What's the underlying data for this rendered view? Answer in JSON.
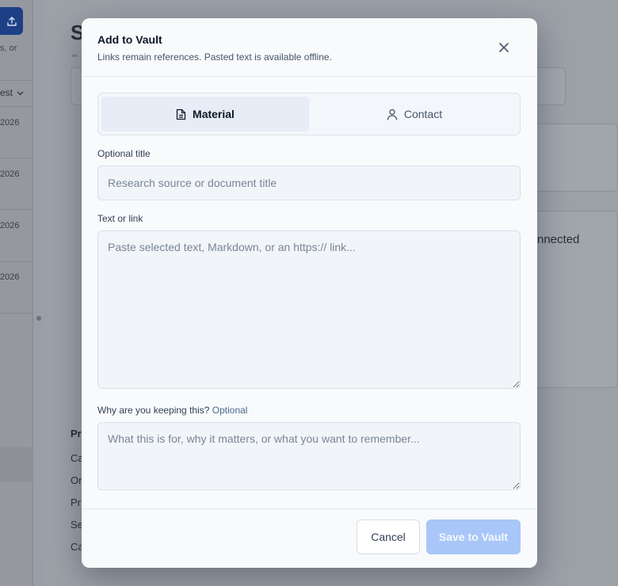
{
  "background": {
    "hint_text": "s, or",
    "sort_label": "est",
    "dates": [
      "2026",
      "2026",
      "2026",
      "2026"
    ],
    "page_title": "S",
    "connected_text": "nnected",
    "section_title": "Pr",
    "section_items": [
      "Ca",
      "Or",
      "Pr",
      "Se",
      "Ca"
    ]
  },
  "modal": {
    "title": "Add to Vault",
    "subtitle": "Links remain references. Pasted text is available offline.",
    "close_icon": "close-icon",
    "tabs": [
      {
        "label": "Material",
        "icon": "document-icon",
        "active": true
      },
      {
        "label": "Contact",
        "icon": "user-icon",
        "active": false
      }
    ],
    "title_field": {
      "label": "Optional title",
      "placeholder": "Research source or document title",
      "value": ""
    },
    "content_field": {
      "label": "Text or link",
      "placeholder": "Paste selected text, Markdown, or an https:// link...",
      "value": ""
    },
    "reason_field": {
      "label": "Why are you keeping this?",
      "optional_label": "Optional",
      "placeholder": "What this is for, why it matters, or what you want to remember...",
      "value": ""
    },
    "footer": {
      "cancel_label": "Cancel",
      "save_label": "Save to Vault"
    }
  },
  "colors": {
    "primary_disabled": "#a8c6f7",
    "upload_button": "#1d3f86",
    "active_tab": "#e6edf6"
  }
}
